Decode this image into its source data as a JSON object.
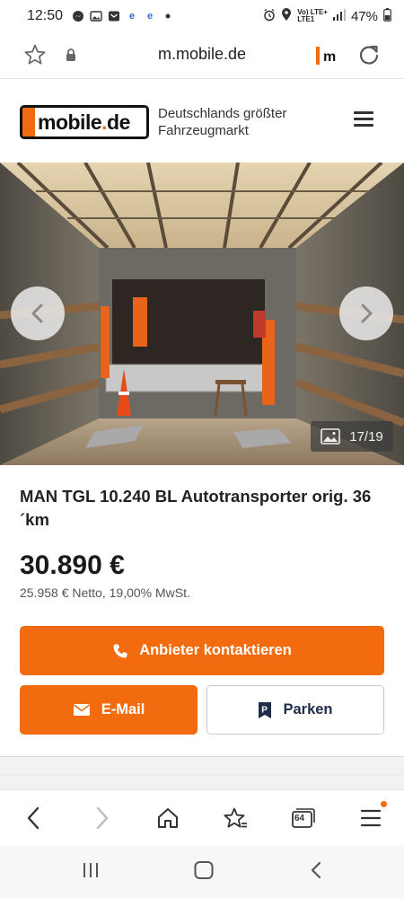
{
  "status_bar": {
    "time": "12:50",
    "lte_top": "Vo) LTE+",
    "lte_bottom": "LTE1",
    "battery": "47%"
  },
  "browser": {
    "url": "m.mobile.de",
    "site_badge": "m"
  },
  "site": {
    "logo_text": "mobile",
    "logo_dot": ".",
    "logo_tld": "de",
    "tagline": "Deutschlands größter Fahrzeugmarkt"
  },
  "gallery": {
    "counter": "17/19"
  },
  "listing": {
    "title": "MAN TGL 10.240 BL Autotransporter orig. 36´km",
    "price": "30.890 €",
    "net_price": "25.958 € Netto, 19,00% MwSt."
  },
  "actions": {
    "contact_label": "Anbieter kontaktieren",
    "email_label": "E-Mail",
    "park_label": "Parken"
  },
  "bottom_bar": {
    "tab_count": "64"
  },
  "colors": {
    "accent": "#f26b0f",
    "navy": "#1f2d4a"
  }
}
